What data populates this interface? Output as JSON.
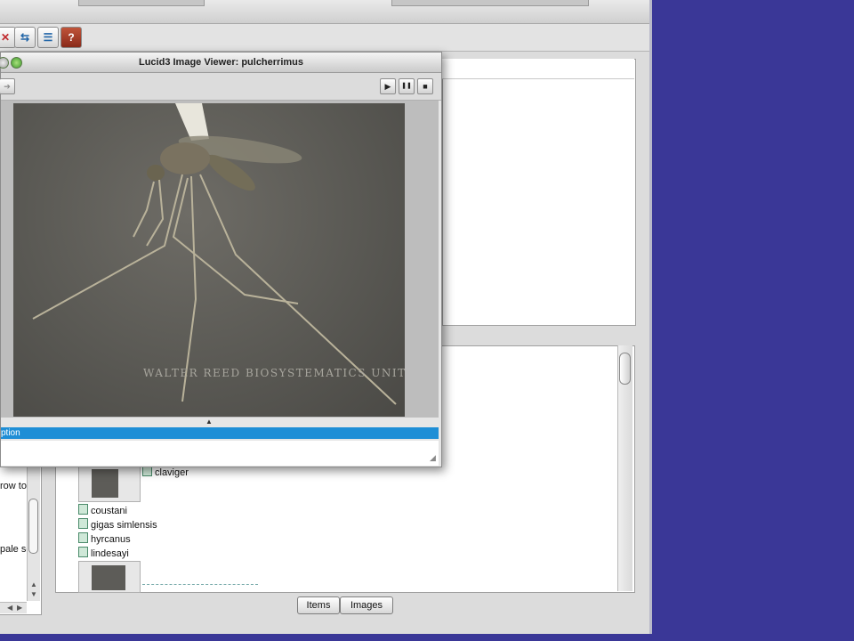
{
  "viewer": {
    "title": "Lucid3 Image Viewer: pulcherrimus",
    "watermark": "WALTER REED BIOSYSTEMATICS UNIT",
    "selected_row": "ption",
    "controls": {
      "play": "▶",
      "pause": "❚❚",
      "stop": "■",
      "forward": "➔"
    }
  },
  "left_pane": {
    "line1": "row to",
    "line2": "pale sc"
  },
  "items_list": [
    "claviger",
    "coustani",
    "gigas simlensis",
    "hyrcanus",
    "lindesayi"
  ],
  "tabs": [
    "Items",
    "Images"
  ],
  "toolbar_icons": [
    "delete-icon",
    "move-icon",
    "sort-icon",
    "help-book-icon"
  ],
  "colors": {
    "selection": "#1e8ed6",
    "desktop": "#3a3797"
  }
}
